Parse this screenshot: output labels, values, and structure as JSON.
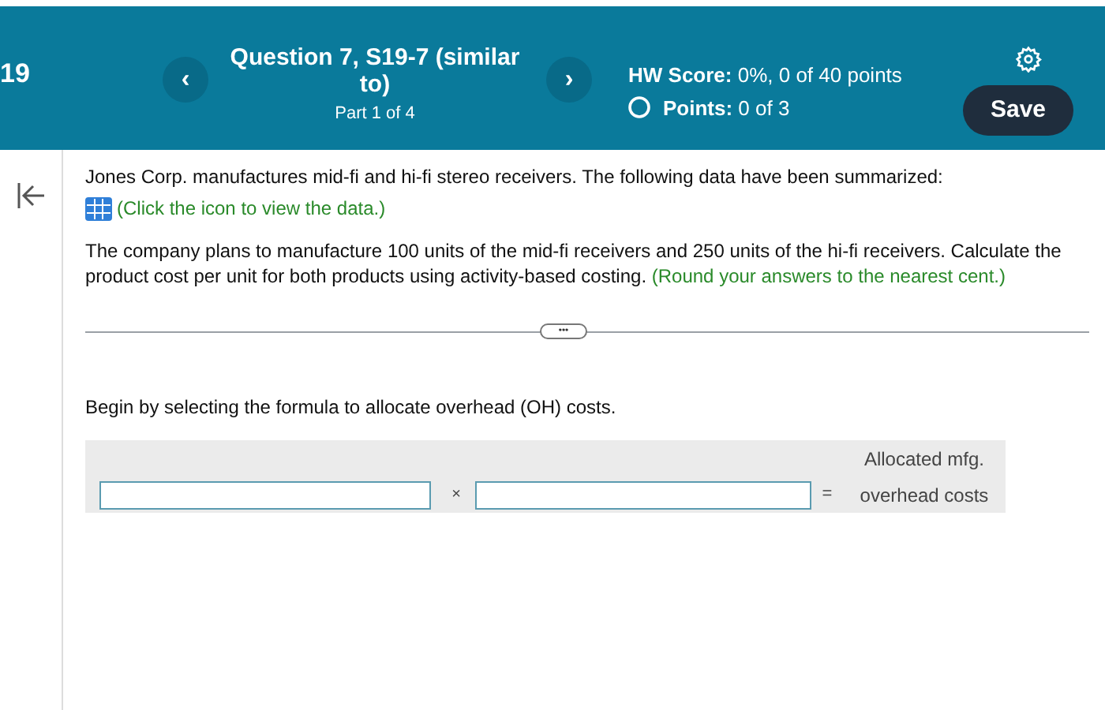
{
  "header": {
    "number": "19",
    "title": "Question 7, S19-7 (similar to)",
    "part": "Part 1 of 4",
    "prev": "‹",
    "next": "›",
    "hw_score_label": "HW Score:",
    "hw_score": "0%, 0 of 40 points",
    "points_label": "Points:",
    "points": "0 of 3",
    "save": "Save"
  },
  "problem": {
    "intro": "Jones Corp. manufactures mid-fi and hi-fi stereo receivers. The following data have been summarized:",
    "data_link": "(Click the icon to view the data.)",
    "task": "The company plans to manufacture 100 units of the mid-fi receivers and 250 units of the hi-fi receivers. Calculate the product cost per unit for both products using activity-based costing.",
    "hint": "(Round your answers to the nearest cent.)",
    "more": "•••"
  },
  "step": {
    "instruction": "Begin by selecting the formula to allocate overhead (OH) costs.",
    "times": "×",
    "equals": "=",
    "result_lines": [
      "Allocated mfg.",
      "overhead costs"
    ]
  }
}
